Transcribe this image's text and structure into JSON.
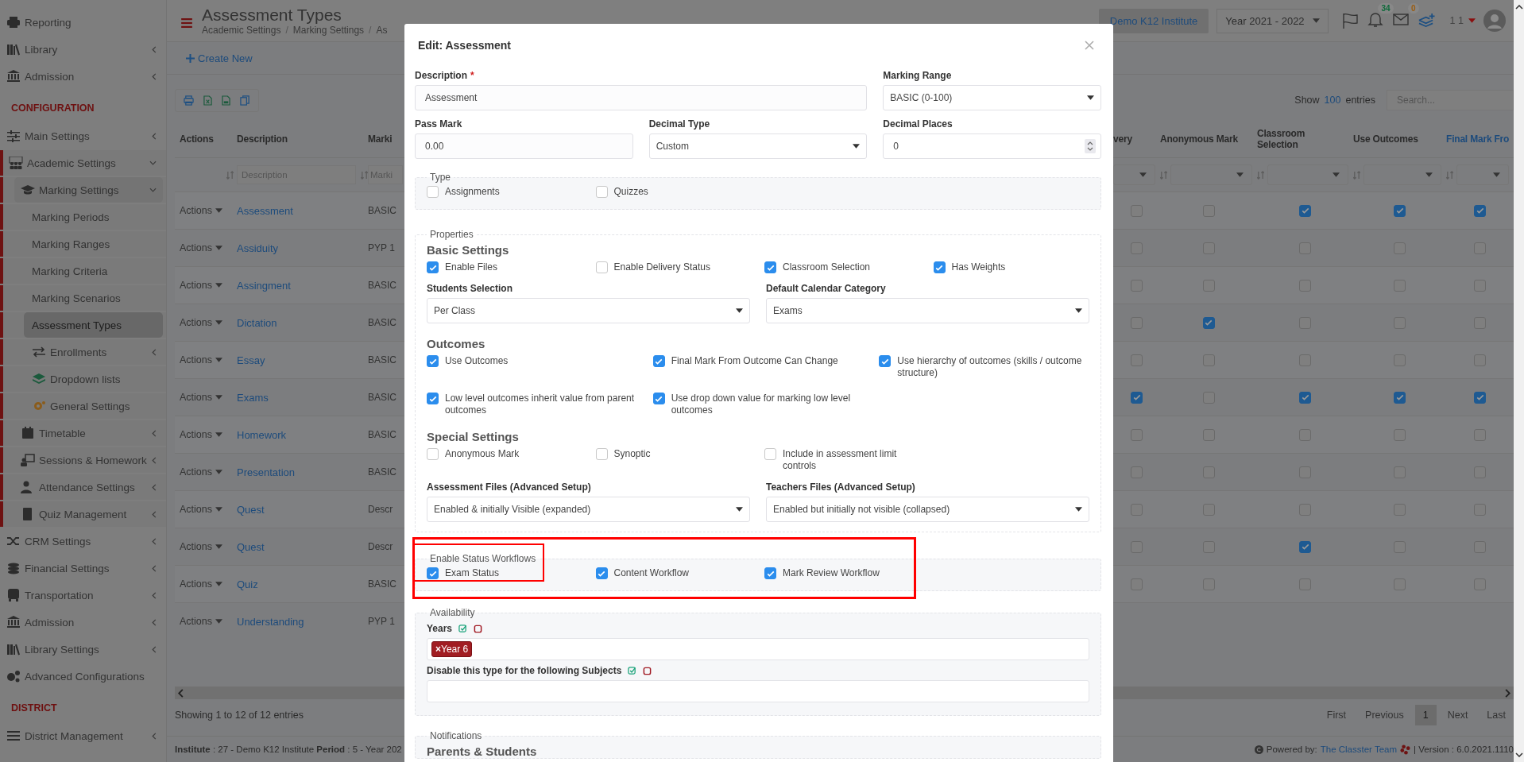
{
  "sidebar": {
    "sections": [
      {
        "items": [
          {
            "label": "Reporting",
            "selected": false
          },
          {
            "label": "Library",
            "selected": false,
            "expanded": false
          },
          {
            "label": "Admission",
            "selected": false,
            "expanded": false
          }
        ]
      },
      {
        "heading": "CONFIGURATION",
        "items": [
          {
            "label": "Main Settings",
            "selected": false,
            "expanded": false
          },
          {
            "label": "Academic Settings",
            "selected": false,
            "expanded": true,
            "children": [
              {
                "label": "Marking Settings",
                "selected": false,
                "expanded": true,
                "children": [
                  {
                    "label": "Marking Periods",
                    "selected": false
                  },
                  {
                    "label": "Marking Ranges",
                    "selected": false
                  },
                  {
                    "label": "Marking Criteria",
                    "selected": false
                  },
                  {
                    "label": "Marking Scenarios",
                    "selected": false
                  },
                  {
                    "label": "Assessment Types",
                    "selected": true
                  },
                  {
                    "label": "Enrollments",
                    "selected": false,
                    "expanded": false
                  },
                  {
                    "label": "Dropdown lists",
                    "selected": false
                  },
                  {
                    "label": "General Settings",
                    "selected": false
                  }
                ]
              },
              {
                "label": "Timetable",
                "selected": false,
                "expanded": false
              },
              {
                "label": "Sessions & Homework",
                "selected": false,
                "expanded": false
              },
              {
                "label": "Attendance Settings",
                "selected": false,
                "expanded": false
              },
              {
                "label": "Quiz Management",
                "selected": false,
                "expanded": false
              }
            ]
          },
          {
            "label": "CRM Settings",
            "selected": false,
            "expanded": false
          },
          {
            "label": "Financial Settings",
            "selected": false,
            "expanded": false
          },
          {
            "label": "Transportation",
            "selected": false,
            "expanded": false
          },
          {
            "label": "Admission",
            "selected": false,
            "expanded": false
          },
          {
            "label": "Library Settings",
            "selected": false,
            "expanded": false
          },
          {
            "label": "Advanced Configurations",
            "selected": false
          }
        ]
      },
      {
        "heading": "DISTRICT",
        "items": [
          {
            "label": "District Management",
            "selected": false,
            "expanded": false
          }
        ]
      }
    ]
  },
  "header": {
    "title": "Assessment Types",
    "breadcrumbs": [
      "Academic Settings",
      "Marking Settings",
      "As"
    ],
    "breadcrumb_separator": "/",
    "institute": "Demo K12 Institute",
    "year": "Year 2021 - 2022",
    "notification_count": "34",
    "message_count": "0",
    "user": "1 1"
  },
  "toolbar": {
    "create_label": "Create New",
    "show_label": "Show",
    "page_size": "100",
    "entries_label": "entries",
    "search_placeholder": "Search..."
  },
  "table": {
    "columns": [
      {
        "label": "Actions"
      },
      {
        "label": "Description"
      },
      {
        "label": "Marki"
      }
    ],
    "flag_columns": [
      {
        "label": "very",
        "sorted": false
      },
      {
        "label": "Anonymous Mark",
        "sorted": false
      },
      {
        "label": "Classroom Selection",
        "sorted": false
      },
      {
        "label": "Use Outcomes",
        "sorted": false
      },
      {
        "label": "Final Mark Fro",
        "sorted": true
      }
    ],
    "filters": {
      "description_placeholder": "Description",
      "marking_placeholder": "Marki"
    },
    "rows": [
      {
        "action": "Actions",
        "description": "Assessment",
        "marking": "BASIC",
        "flags": [
          false,
          false,
          true,
          true,
          true
        ]
      },
      {
        "action": "Actions",
        "description": "Assiduity",
        "marking": "PYP 1",
        "flags": [
          false,
          false,
          false,
          false,
          false
        ]
      },
      {
        "action": "Actions",
        "description": "Assingment",
        "marking": "BASIC",
        "flags": [
          false,
          false,
          false,
          false,
          false
        ]
      },
      {
        "action": "Actions",
        "description": "Dictation",
        "marking": "BASIC",
        "flags": [
          false,
          true,
          false,
          false,
          false
        ]
      },
      {
        "action": "Actions",
        "description": "Essay",
        "marking": "BASIC",
        "flags": [
          false,
          false,
          false,
          false,
          false
        ]
      },
      {
        "action": "Actions",
        "description": "Exams",
        "marking": "BASIC",
        "flags": [
          true,
          false,
          true,
          true,
          true
        ]
      },
      {
        "action": "Actions",
        "description": "Homework",
        "marking": "BASIC",
        "flags": [
          false,
          false,
          false,
          false,
          false
        ]
      },
      {
        "action": "Actions",
        "description": "Presentation",
        "marking": "BASIC",
        "flags": [
          false,
          false,
          false,
          false,
          false
        ]
      },
      {
        "action": "Actions",
        "description": "Quest",
        "marking": "Descr",
        "flags": [
          false,
          false,
          false,
          false,
          false
        ]
      },
      {
        "action": "Actions",
        "description": "Quest",
        "marking": "Descr",
        "flags": [
          false,
          false,
          true,
          false,
          false
        ]
      },
      {
        "action": "Actions",
        "description": "Quiz",
        "marking": "BASIC",
        "flags": [
          false,
          false,
          false,
          false,
          false
        ]
      },
      {
        "action": "Actions",
        "description": "Understanding",
        "marking": "PYP 1"
      }
    ],
    "info": "Showing 1 to 12 of 12 entries",
    "pages": [
      {
        "label": "First",
        "selected": false
      },
      {
        "label": "Previous",
        "selected": false
      },
      {
        "label": "1",
        "selected": true
      },
      {
        "label": "Next",
        "selected": false
      },
      {
        "label": "Last",
        "selected": false
      }
    ]
  },
  "footer": {
    "left": "**Institute** : 27 - Demo K12 Institute **Period** : 5 - Year 202",
    "powered_label": "Powered by:",
    "team_link": "The Classter Team",
    "version": "| Version : 6.0.2021.1110"
  },
  "modal": {
    "title": "Edit: Assessment",
    "fields": [
      {
        "kind": "text",
        "label": "Description",
        "required_mark": "*",
        "value": "Assessment"
      },
      {
        "kind": "select",
        "label": "Marking Range",
        "value": "BASIC (0-100)"
      },
      {
        "kind": "text",
        "label": "Pass Mark",
        "value": "0.00"
      },
      {
        "kind": "select",
        "label": "Decimal Type",
        "value": "Custom"
      },
      {
        "kind": "number",
        "label": "Decimal Places",
        "value": "0"
      }
    ],
    "type_group": {
      "legend": "Type",
      "options": [
        {
          "label": "Assignments",
          "checked": false
        },
        {
          "label": "Quizzes",
          "checked": false
        }
      ]
    },
    "properties": {
      "legend": "Properties",
      "sections": [
        {
          "heading": "Basic Settings",
          "kind": "quarters",
          "options": [
            {
              "label": "Enable Files",
              "checked": true
            },
            {
              "label": "Enable Delivery Status",
              "checked": false
            },
            {
              "label": "Classroom Selection",
              "checked": true
            },
            {
              "label": "Has Weights",
              "checked": true
            }
          ],
          "selects": [
            {
              "label": "Students Selection",
              "value": "Per Class"
            },
            {
              "label": "Default Calendar Category",
              "value": "Exams"
            }
          ]
        },
        {
          "heading": "Outcomes",
          "kind": "thirds",
          "options": [
            {
              "label": "Use Outcomes",
              "checked": true
            },
            {
              "label": "Final Mark From Outcome Can Change",
              "checked": true
            },
            {
              "label": "Use hierarchy of outcomes (skills / outcome structure)",
              "checked": true
            },
            {
              "label": "Low level outcomes inherit value from parent outcomes",
              "checked": true
            },
            {
              "label": "Use drop down value for marking low level outcomes",
              "checked": true
            }
          ]
        },
        {
          "heading": "Special Settings",
          "kind": "quarters",
          "options": [
            {
              "label": "Anonymous Mark",
              "checked": false
            },
            {
              "label": "Synoptic",
              "checked": false
            },
            {
              "label": "Include in assessment limit controls",
              "checked": false
            }
          ],
          "selects": [
            {
              "label": "Assessment Files (Advanced Setup)",
              "value": "Enabled & initially Visible (expanded)"
            },
            {
              "label": "Teachers Files (Advanced Setup)",
              "value": "Enabled but initially not visible (collapsed)"
            }
          ]
        }
      ]
    },
    "workflows": {
      "legend": "Enable Status Workflows",
      "options": [
        {
          "label": "Exam Status",
          "checked": true
        },
        {
          "label": "Content Workflow",
          "checked": true
        },
        {
          "label": "Mark Review Workflow",
          "checked": true
        }
      ]
    },
    "availability": {
      "legend": "Availability",
      "fields": [
        {
          "label": "Years",
          "tags": [
            {
              "remove": "×",
              "label": "Year 6"
            }
          ]
        },
        {
          "label": "Disable this type for the following Subjects"
        }
      ]
    },
    "notifications": {
      "legend": "Notifications",
      "heading": "Parents & Students"
    }
  }
}
